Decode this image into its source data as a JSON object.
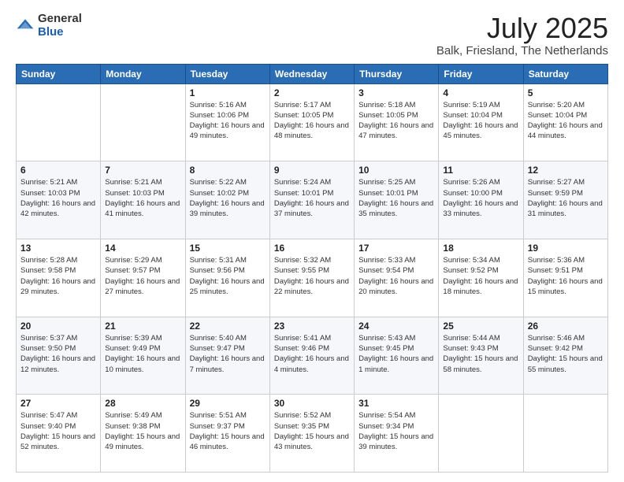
{
  "header": {
    "logo_general": "General",
    "logo_blue": "Blue",
    "title": "July 2025",
    "subtitle": "Balk, Friesland, The Netherlands"
  },
  "weekdays": [
    "Sunday",
    "Monday",
    "Tuesday",
    "Wednesday",
    "Thursday",
    "Friday",
    "Saturday"
  ],
  "weeks": [
    [
      {
        "day": "",
        "info": ""
      },
      {
        "day": "",
        "info": ""
      },
      {
        "day": "1",
        "info": "Sunrise: 5:16 AM\nSunset: 10:06 PM\nDaylight: 16 hours and 49 minutes."
      },
      {
        "day": "2",
        "info": "Sunrise: 5:17 AM\nSunset: 10:05 PM\nDaylight: 16 hours and 48 minutes."
      },
      {
        "day": "3",
        "info": "Sunrise: 5:18 AM\nSunset: 10:05 PM\nDaylight: 16 hours and 47 minutes."
      },
      {
        "day": "4",
        "info": "Sunrise: 5:19 AM\nSunset: 10:04 PM\nDaylight: 16 hours and 45 minutes."
      },
      {
        "day": "5",
        "info": "Sunrise: 5:20 AM\nSunset: 10:04 PM\nDaylight: 16 hours and 44 minutes."
      }
    ],
    [
      {
        "day": "6",
        "info": "Sunrise: 5:21 AM\nSunset: 10:03 PM\nDaylight: 16 hours and 42 minutes."
      },
      {
        "day": "7",
        "info": "Sunrise: 5:21 AM\nSunset: 10:03 PM\nDaylight: 16 hours and 41 minutes."
      },
      {
        "day": "8",
        "info": "Sunrise: 5:22 AM\nSunset: 10:02 PM\nDaylight: 16 hours and 39 minutes."
      },
      {
        "day": "9",
        "info": "Sunrise: 5:24 AM\nSunset: 10:01 PM\nDaylight: 16 hours and 37 minutes."
      },
      {
        "day": "10",
        "info": "Sunrise: 5:25 AM\nSunset: 10:01 PM\nDaylight: 16 hours and 35 minutes."
      },
      {
        "day": "11",
        "info": "Sunrise: 5:26 AM\nSunset: 10:00 PM\nDaylight: 16 hours and 33 minutes."
      },
      {
        "day": "12",
        "info": "Sunrise: 5:27 AM\nSunset: 9:59 PM\nDaylight: 16 hours and 31 minutes."
      }
    ],
    [
      {
        "day": "13",
        "info": "Sunrise: 5:28 AM\nSunset: 9:58 PM\nDaylight: 16 hours and 29 minutes."
      },
      {
        "day": "14",
        "info": "Sunrise: 5:29 AM\nSunset: 9:57 PM\nDaylight: 16 hours and 27 minutes."
      },
      {
        "day": "15",
        "info": "Sunrise: 5:31 AM\nSunset: 9:56 PM\nDaylight: 16 hours and 25 minutes."
      },
      {
        "day": "16",
        "info": "Sunrise: 5:32 AM\nSunset: 9:55 PM\nDaylight: 16 hours and 22 minutes."
      },
      {
        "day": "17",
        "info": "Sunrise: 5:33 AM\nSunset: 9:54 PM\nDaylight: 16 hours and 20 minutes."
      },
      {
        "day": "18",
        "info": "Sunrise: 5:34 AM\nSunset: 9:52 PM\nDaylight: 16 hours and 18 minutes."
      },
      {
        "day": "19",
        "info": "Sunrise: 5:36 AM\nSunset: 9:51 PM\nDaylight: 16 hours and 15 minutes."
      }
    ],
    [
      {
        "day": "20",
        "info": "Sunrise: 5:37 AM\nSunset: 9:50 PM\nDaylight: 16 hours and 12 minutes."
      },
      {
        "day": "21",
        "info": "Sunrise: 5:39 AM\nSunset: 9:49 PM\nDaylight: 16 hours and 10 minutes."
      },
      {
        "day": "22",
        "info": "Sunrise: 5:40 AM\nSunset: 9:47 PM\nDaylight: 16 hours and 7 minutes."
      },
      {
        "day": "23",
        "info": "Sunrise: 5:41 AM\nSunset: 9:46 PM\nDaylight: 16 hours and 4 minutes."
      },
      {
        "day": "24",
        "info": "Sunrise: 5:43 AM\nSunset: 9:45 PM\nDaylight: 16 hours and 1 minute."
      },
      {
        "day": "25",
        "info": "Sunrise: 5:44 AM\nSunset: 9:43 PM\nDaylight: 15 hours and 58 minutes."
      },
      {
        "day": "26",
        "info": "Sunrise: 5:46 AM\nSunset: 9:42 PM\nDaylight: 15 hours and 55 minutes."
      }
    ],
    [
      {
        "day": "27",
        "info": "Sunrise: 5:47 AM\nSunset: 9:40 PM\nDaylight: 15 hours and 52 minutes."
      },
      {
        "day": "28",
        "info": "Sunrise: 5:49 AM\nSunset: 9:38 PM\nDaylight: 15 hours and 49 minutes."
      },
      {
        "day": "29",
        "info": "Sunrise: 5:51 AM\nSunset: 9:37 PM\nDaylight: 15 hours and 46 minutes."
      },
      {
        "day": "30",
        "info": "Sunrise: 5:52 AM\nSunset: 9:35 PM\nDaylight: 15 hours and 43 minutes."
      },
      {
        "day": "31",
        "info": "Sunrise: 5:54 AM\nSunset: 9:34 PM\nDaylight: 15 hours and 39 minutes."
      },
      {
        "day": "",
        "info": ""
      },
      {
        "day": "",
        "info": ""
      }
    ]
  ]
}
